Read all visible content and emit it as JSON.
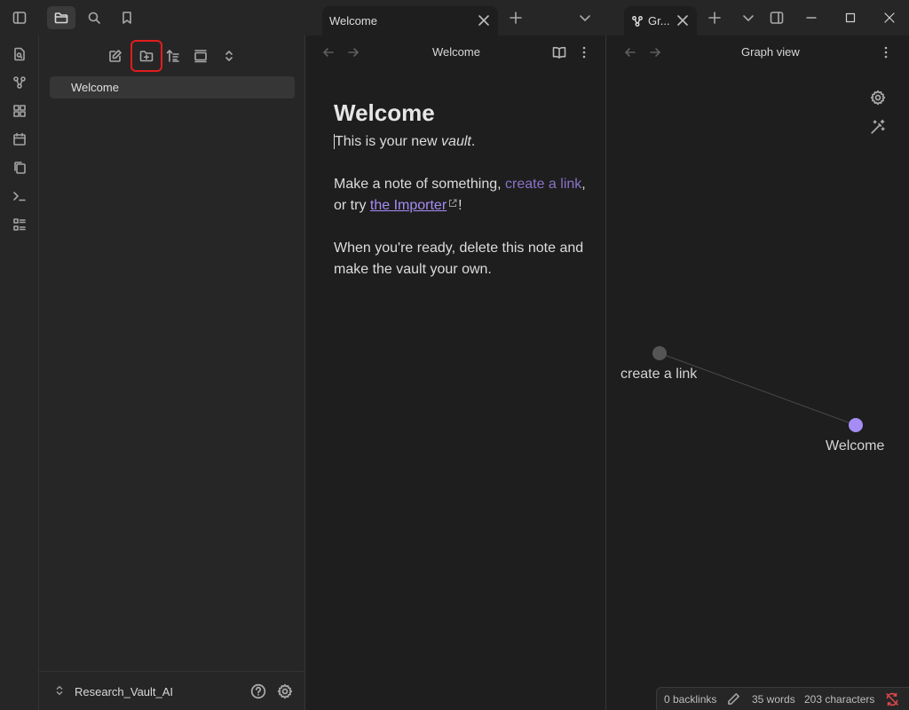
{
  "tabs": {
    "welcome": {
      "label": "Welcome"
    },
    "graph": {
      "label": "Gr..."
    }
  },
  "sidebar": {
    "files": [
      {
        "label": "Welcome"
      }
    ],
    "vault_name": "Research_Vault_AI"
  },
  "editor": {
    "header_title": "Welcome",
    "doc_title": "Welcome",
    "line1_prefix": "This is your new ",
    "line1_em": "vault",
    "line1_suffix": ".",
    "line2_prefix": "Make a note of something, ",
    "line2_link": "create a link",
    "line2_mid": ", or try ",
    "line2_ext_link": "the Importer",
    "line2_suffix": "!",
    "line3": "When you're ready, delete this note and make the vault your own."
  },
  "graph": {
    "header_title": "Graph view",
    "nodes": [
      {
        "label": "create a link",
        "color": "#555555"
      },
      {
        "label": "Welcome",
        "color": "#a68cf5"
      }
    ]
  },
  "status": {
    "backlinks": "0 backlinks",
    "words": "35 words",
    "characters": "203 characters"
  },
  "colors": {
    "accent": "#a68cf5",
    "highlight_box": "#e11d1d",
    "sync_error": "#e5484d"
  }
}
